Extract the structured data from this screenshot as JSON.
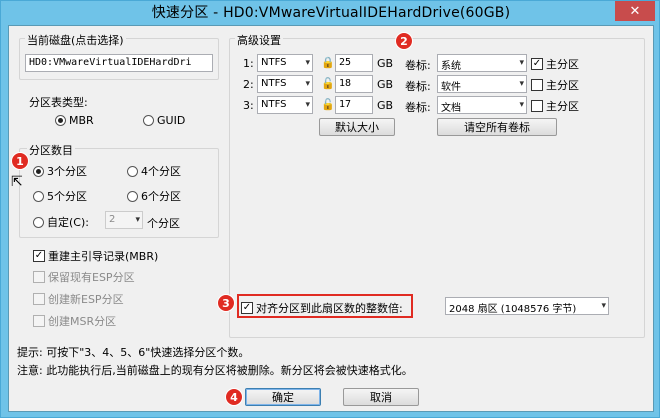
{
  "window": {
    "title": "快速分区 - HD0:VMwareVirtualIDEHardDrive(60GB)",
    "close_glyph": "✕"
  },
  "disk": {
    "title": "当前磁盘(点击选择)",
    "value": "HD0:VMwareVirtualIDEHardDri"
  },
  "partition_table": {
    "label": "分区表类型:",
    "options": [
      "MBR",
      "GUID"
    ],
    "selected": "MBR"
  },
  "partition_count": {
    "title": "分区数目",
    "options": [
      "3个分区",
      "4个分区",
      "5个分区",
      "6个分区"
    ],
    "selected": "3个分区",
    "custom_label": "自定(C):",
    "custom_value": "2",
    "custom_suffix": "个分区"
  },
  "options": {
    "rebuild_mbr": "重建主引导记录(MBR)",
    "keep_esp": "保留现有ESP分区",
    "create_esp": "创建新ESP分区",
    "create_msr": "创建MSR分区"
  },
  "advanced": {
    "title": "高级设置",
    "size_unit": "GB",
    "volume_label_text": "卷标:",
    "primary_text": "主分区",
    "rows": [
      {
        "index": "1:",
        "fs": "NTFS",
        "size": "25",
        "label": "系统",
        "primary": true
      },
      {
        "index": "2:",
        "fs": "NTFS",
        "size": "18",
        "label": "软件",
        "primary": false
      },
      {
        "index": "3:",
        "fs": "NTFS",
        "size": "17",
        "label": "文档",
        "primary": false
      }
    ],
    "default_size_button": "默认大小",
    "clear_labels_button": "请空所有卷标"
  },
  "align": {
    "label": "对齐分区到此扇区数的整数倍:",
    "value": "2048 扇区 (1048576 字节)"
  },
  "tips": {
    "line1": "提示: 可按下\"3、4、5、6\"快速选择分区个数。",
    "line2": "注意: 此功能执行后,当前磁盘上的现有分区将被删除。新分区将会被快速格式化。"
  },
  "buttons": {
    "ok": "确定",
    "cancel": "取消"
  },
  "badges": [
    "1",
    "2",
    "3",
    "4"
  ]
}
